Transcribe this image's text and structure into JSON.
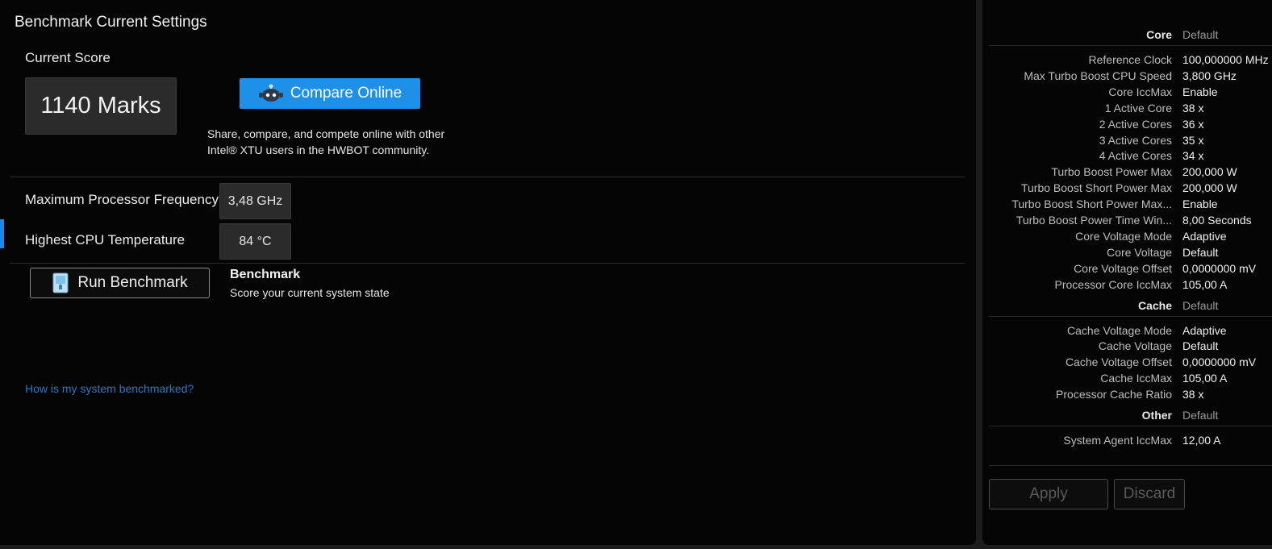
{
  "benchmark": {
    "title": "Benchmark Current Settings",
    "score_label": "Current Score",
    "score_value": "1140 Marks",
    "compare_label": "Compare Online",
    "compare_desc_line1": "Share, compare, and compete online with other",
    "compare_desc_line2": "Intel® XTU users in the HWBOT community.",
    "max_freq_label": "Maximum Processor Frequency",
    "max_freq_value": "3,48 GHz",
    "temp_label": "Highest CPU Temperature",
    "temp_value": "84 °C",
    "run_label": "Run Benchmark",
    "bench_title": "Benchmark",
    "bench_desc": "Score your current system state",
    "help_link": "How is my system benchmarked?"
  },
  "settings": {
    "sections": [
      {
        "name": "Core",
        "default_label": "Default",
        "rows": [
          {
            "k": "Reference Clock",
            "v": "100,000000 MHz"
          },
          {
            "k": "Max Turbo Boost CPU Speed",
            "v": "3,800 GHz"
          },
          {
            "k": "Core IccMax",
            "v": "Enable"
          },
          {
            "k": "1 Active Core",
            "v": "38 x"
          },
          {
            "k": "2 Active Cores",
            "v": "36 x"
          },
          {
            "k": "3 Active Cores",
            "v": "35 x"
          },
          {
            "k": "4 Active Cores",
            "v": "34 x"
          },
          {
            "k": "Turbo Boost Power Max",
            "v": "200,000 W"
          },
          {
            "k": "Turbo Boost Short Power Max",
            "v": "200,000 W"
          },
          {
            "k": "Turbo Boost Short Power Max...",
            "v": "Enable"
          },
          {
            "k": "Turbo Boost Power Time Win...",
            "v": "8,00 Seconds"
          },
          {
            "k": "Core Voltage Mode",
            "v": "Adaptive"
          },
          {
            "k": "Core Voltage",
            "v": "Default"
          },
          {
            "k": "Core Voltage Offset",
            "v": "0,0000000 mV"
          },
          {
            "k": "Processor Core IccMax",
            "v": "105,00 A"
          }
        ]
      },
      {
        "name": "Cache",
        "default_label": "Default",
        "rows": [
          {
            "k": "Cache Voltage Mode",
            "v": "Adaptive"
          },
          {
            "k": "Cache Voltage",
            "v": "Default"
          },
          {
            "k": "Cache Voltage Offset",
            "v": "0,0000000 mV"
          },
          {
            "k": "Cache IccMax",
            "v": "105,00 A"
          },
          {
            "k": "Processor Cache Ratio",
            "v": "38 x"
          }
        ]
      },
      {
        "name": "Other",
        "default_label": "Default",
        "rows": [
          {
            "k": "System Agent IccMax",
            "v": "12,00 A"
          }
        ]
      }
    ],
    "apply_label": "Apply",
    "discard_label": "Discard"
  }
}
